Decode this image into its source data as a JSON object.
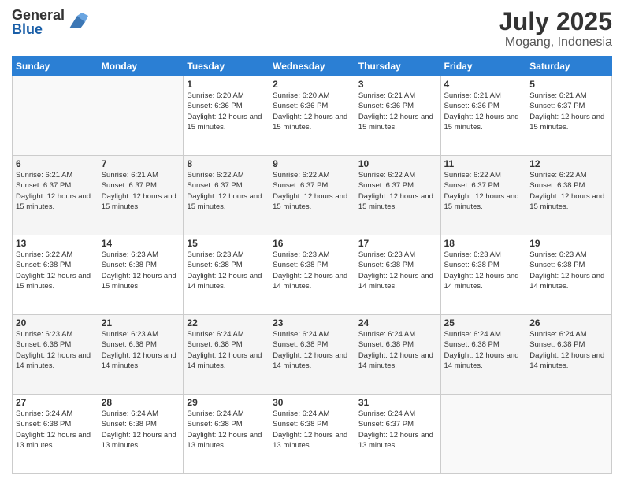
{
  "header": {
    "logo_general": "General",
    "logo_blue": "Blue",
    "month": "July 2025",
    "location": "Mogang, Indonesia"
  },
  "weekdays": [
    "Sunday",
    "Monday",
    "Tuesday",
    "Wednesday",
    "Thursday",
    "Friday",
    "Saturday"
  ],
  "weeks": [
    [
      {
        "day": "",
        "sunrise": "",
        "sunset": "",
        "daylight": ""
      },
      {
        "day": "",
        "sunrise": "",
        "sunset": "",
        "daylight": ""
      },
      {
        "day": "1",
        "sunrise": "Sunrise: 6:20 AM",
        "sunset": "Sunset: 6:36 PM",
        "daylight": "Daylight: 12 hours and 15 minutes."
      },
      {
        "day": "2",
        "sunrise": "Sunrise: 6:20 AM",
        "sunset": "Sunset: 6:36 PM",
        "daylight": "Daylight: 12 hours and 15 minutes."
      },
      {
        "day": "3",
        "sunrise": "Sunrise: 6:21 AM",
        "sunset": "Sunset: 6:36 PM",
        "daylight": "Daylight: 12 hours and 15 minutes."
      },
      {
        "day": "4",
        "sunrise": "Sunrise: 6:21 AM",
        "sunset": "Sunset: 6:36 PM",
        "daylight": "Daylight: 12 hours and 15 minutes."
      },
      {
        "day": "5",
        "sunrise": "Sunrise: 6:21 AM",
        "sunset": "Sunset: 6:37 PM",
        "daylight": "Daylight: 12 hours and 15 minutes."
      }
    ],
    [
      {
        "day": "6",
        "sunrise": "Sunrise: 6:21 AM",
        "sunset": "Sunset: 6:37 PM",
        "daylight": "Daylight: 12 hours and 15 minutes."
      },
      {
        "day": "7",
        "sunrise": "Sunrise: 6:21 AM",
        "sunset": "Sunset: 6:37 PM",
        "daylight": "Daylight: 12 hours and 15 minutes."
      },
      {
        "day": "8",
        "sunrise": "Sunrise: 6:22 AM",
        "sunset": "Sunset: 6:37 PM",
        "daylight": "Daylight: 12 hours and 15 minutes."
      },
      {
        "day": "9",
        "sunrise": "Sunrise: 6:22 AM",
        "sunset": "Sunset: 6:37 PM",
        "daylight": "Daylight: 12 hours and 15 minutes."
      },
      {
        "day": "10",
        "sunrise": "Sunrise: 6:22 AM",
        "sunset": "Sunset: 6:37 PM",
        "daylight": "Daylight: 12 hours and 15 minutes."
      },
      {
        "day": "11",
        "sunrise": "Sunrise: 6:22 AM",
        "sunset": "Sunset: 6:37 PM",
        "daylight": "Daylight: 12 hours and 15 minutes."
      },
      {
        "day": "12",
        "sunrise": "Sunrise: 6:22 AM",
        "sunset": "Sunset: 6:38 PM",
        "daylight": "Daylight: 12 hours and 15 minutes."
      }
    ],
    [
      {
        "day": "13",
        "sunrise": "Sunrise: 6:22 AM",
        "sunset": "Sunset: 6:38 PM",
        "daylight": "Daylight: 12 hours and 15 minutes."
      },
      {
        "day": "14",
        "sunrise": "Sunrise: 6:23 AM",
        "sunset": "Sunset: 6:38 PM",
        "daylight": "Daylight: 12 hours and 15 minutes."
      },
      {
        "day": "15",
        "sunrise": "Sunrise: 6:23 AM",
        "sunset": "Sunset: 6:38 PM",
        "daylight": "Daylight: 12 hours and 14 minutes."
      },
      {
        "day": "16",
        "sunrise": "Sunrise: 6:23 AM",
        "sunset": "Sunset: 6:38 PM",
        "daylight": "Daylight: 12 hours and 14 minutes."
      },
      {
        "day": "17",
        "sunrise": "Sunrise: 6:23 AM",
        "sunset": "Sunset: 6:38 PM",
        "daylight": "Daylight: 12 hours and 14 minutes."
      },
      {
        "day": "18",
        "sunrise": "Sunrise: 6:23 AM",
        "sunset": "Sunset: 6:38 PM",
        "daylight": "Daylight: 12 hours and 14 minutes."
      },
      {
        "day": "19",
        "sunrise": "Sunrise: 6:23 AM",
        "sunset": "Sunset: 6:38 PM",
        "daylight": "Daylight: 12 hours and 14 minutes."
      }
    ],
    [
      {
        "day": "20",
        "sunrise": "Sunrise: 6:23 AM",
        "sunset": "Sunset: 6:38 PM",
        "daylight": "Daylight: 12 hours and 14 minutes."
      },
      {
        "day": "21",
        "sunrise": "Sunrise: 6:23 AM",
        "sunset": "Sunset: 6:38 PM",
        "daylight": "Daylight: 12 hours and 14 minutes."
      },
      {
        "day": "22",
        "sunrise": "Sunrise: 6:24 AM",
        "sunset": "Sunset: 6:38 PM",
        "daylight": "Daylight: 12 hours and 14 minutes."
      },
      {
        "day": "23",
        "sunrise": "Sunrise: 6:24 AM",
        "sunset": "Sunset: 6:38 PM",
        "daylight": "Daylight: 12 hours and 14 minutes."
      },
      {
        "day": "24",
        "sunrise": "Sunrise: 6:24 AM",
        "sunset": "Sunset: 6:38 PM",
        "daylight": "Daylight: 12 hours and 14 minutes."
      },
      {
        "day": "25",
        "sunrise": "Sunrise: 6:24 AM",
        "sunset": "Sunset: 6:38 PM",
        "daylight": "Daylight: 12 hours and 14 minutes."
      },
      {
        "day": "26",
        "sunrise": "Sunrise: 6:24 AM",
        "sunset": "Sunset: 6:38 PM",
        "daylight": "Daylight: 12 hours and 14 minutes."
      }
    ],
    [
      {
        "day": "27",
        "sunrise": "Sunrise: 6:24 AM",
        "sunset": "Sunset: 6:38 PM",
        "daylight": "Daylight: 12 hours and 13 minutes."
      },
      {
        "day": "28",
        "sunrise": "Sunrise: 6:24 AM",
        "sunset": "Sunset: 6:38 PM",
        "daylight": "Daylight: 12 hours and 13 minutes."
      },
      {
        "day": "29",
        "sunrise": "Sunrise: 6:24 AM",
        "sunset": "Sunset: 6:38 PM",
        "daylight": "Daylight: 12 hours and 13 minutes."
      },
      {
        "day": "30",
        "sunrise": "Sunrise: 6:24 AM",
        "sunset": "Sunset: 6:38 PM",
        "daylight": "Daylight: 12 hours and 13 minutes."
      },
      {
        "day": "31",
        "sunrise": "Sunrise: 6:24 AM",
        "sunset": "Sunset: 6:37 PM",
        "daylight": "Daylight: 12 hours and 13 minutes."
      },
      {
        "day": "",
        "sunrise": "",
        "sunset": "",
        "daylight": ""
      },
      {
        "day": "",
        "sunrise": "",
        "sunset": "",
        "daylight": ""
      }
    ]
  ]
}
